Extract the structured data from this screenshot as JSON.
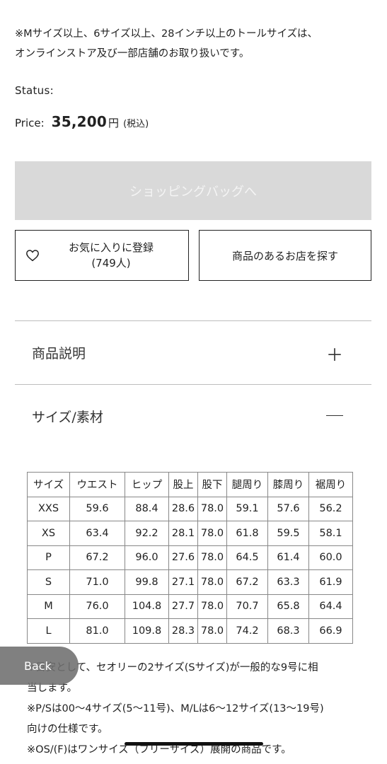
{
  "note_top": [
    "※Mサイズ以上、6サイズ以上、28インチ以上のトールサイズは、",
    "オンラインストア及び一部店舗のお取り扱いです。"
  ],
  "status_label": "Status:",
  "price": {
    "label": "Price:",
    "value": "35,200",
    "yen": "円",
    "tax": "(税込)"
  },
  "bag_button": "ショッピングバッグへ",
  "favorite": {
    "label": "お気に入りに登録",
    "count": "(749人)",
    "icon": "heart-icon"
  },
  "store_button": "商品のあるお店を探す",
  "accordion": [
    {
      "title": "商品説明",
      "sign": "＋"
    },
    {
      "title": "サイズ/素材",
      "sign": "―"
    }
  ],
  "size_table": {
    "headers": [
      "サイズ",
      "ウエスト",
      "ヒップ",
      "股上",
      "股下",
      "腿周り",
      "膝周り",
      "裾周り"
    ],
    "rows": [
      [
        "XXS",
        "59.6",
        "88.4",
        "28.6",
        "78.0",
        "59.1",
        "57.6",
        "56.2"
      ],
      [
        "XS",
        "63.4",
        "92.2",
        "28.1",
        "78.0",
        "61.8",
        "59.5",
        "58.1"
      ],
      [
        "P",
        "67.2",
        "96.0",
        "27.6",
        "78.0",
        "64.5",
        "61.4",
        "60.0"
      ],
      [
        "S",
        "71.0",
        "99.8",
        "27.1",
        "78.0",
        "67.2",
        "63.3",
        "61.9"
      ],
      [
        "M",
        "76.0",
        "104.8",
        "27.7",
        "78.0",
        "70.7",
        "65.8",
        "64.4"
      ],
      [
        "L",
        "81.0",
        "109.8",
        "28.3",
        "78.0",
        "74.2",
        "68.3",
        "66.9"
      ]
    ]
  },
  "notes": [
    "※目安として、セオリーの2サイズ(Sサイズ)が一般的な9号に相",
    "当します。",
    "※P/Sは00〜4サイズ(5〜11号)、M/Lは6〜12サイズ(13〜19号)",
    "向けの仕様です。",
    "※OS/(F)はワンサイズ（フリーサイズ）展開の商品です。"
  ],
  "back_button": "Back"
}
